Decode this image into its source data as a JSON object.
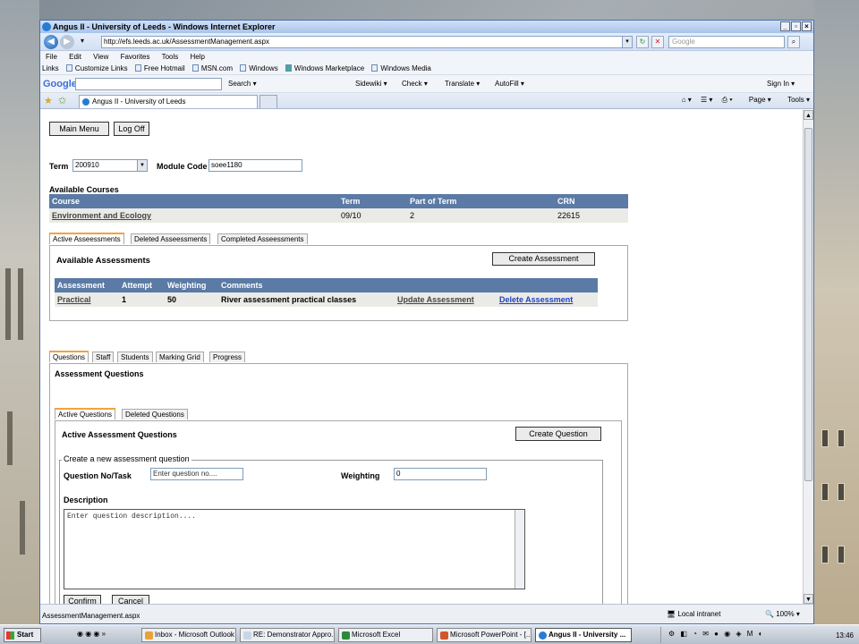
{
  "browser": {
    "title": "Angus II - University of Leeds - Windows Internet Explorer",
    "url": "http://efs.leeds.ac.uk/AssessmentManagement.aspx",
    "search_placeholder": "Google",
    "menu": [
      "File",
      "Edit",
      "View",
      "Favorites",
      "Tools",
      "Help"
    ],
    "links_label": "Links",
    "links": [
      "Customize Links",
      "Free Hotmail",
      "MSN.com",
      "Windows",
      "Windows Marketplace",
      "Windows Media"
    ],
    "google_logo": "Google",
    "google_items": [
      "Search",
      "Sidewiki",
      "Check",
      "Translate",
      "AutoFill"
    ],
    "sign_in": "Sign In",
    "tab_title": "Angus II - University of Leeds",
    "tools": [
      "Page",
      "Tools"
    ],
    "status": "AssessmentManagement.aspx",
    "zone": "Local intranet",
    "zoom": "100%"
  },
  "page": {
    "main_menu": "Main Menu",
    "log_off": "Log Off",
    "term_label": "Term",
    "term_value": "200910",
    "module_label": "Module Code",
    "module_value": "soee1180",
    "available_courses": "Available Courses",
    "courses": {
      "headers": [
        "Course",
        "Term",
        "Part of Term",
        "CRN"
      ],
      "rows": [
        [
          "Environment and Ecology",
          "09/10",
          "2",
          "22615"
        ]
      ]
    },
    "assessment_tabs": [
      "Active Asseessments",
      "Deleted Asseessments",
      "Completed Asseessments"
    ],
    "available_assessments": "Available Assessments",
    "create_assessment": "Create Assessment",
    "assessments": {
      "headers": [
        "Assessment",
        "Attempt",
        "Weighting",
        "Comments"
      ],
      "row": {
        "assessment": "Practical",
        "attempt": "1",
        "weighting": "50",
        "comments": "River assessment practical classes",
        "update": "Update Assessment",
        "delete": "Delete Assessment"
      }
    },
    "detail_tabs": [
      "Questions",
      "Staff",
      "Students",
      "Marking Grid",
      "Progress"
    ],
    "assessment_questions": "Assessment Questions",
    "question_tabs": [
      "Active Questions",
      "Deleted Questions"
    ],
    "active_assessment_questions": "Active Assessment Questions",
    "create_question": "Create Question",
    "legend": "Create a new assessment question",
    "question_no_label": "Question No/Task",
    "question_no_placeholder": "Enter question no....",
    "weighting_label": "Weighting",
    "weighting_value": "0",
    "description_label": "Description",
    "description_placeholder": "Enter question description....",
    "confirm": "Confirm",
    "cancel": "Cancel"
  },
  "taskbar": {
    "start": "Start",
    "items": [
      "Inbox - Microsoft Outlook",
      "RE: Demonstrator Appro...",
      "Microsoft Excel",
      "Microsoft PowerPoint - [...",
      "Angus II - University ..."
    ],
    "clock": "13:46"
  }
}
